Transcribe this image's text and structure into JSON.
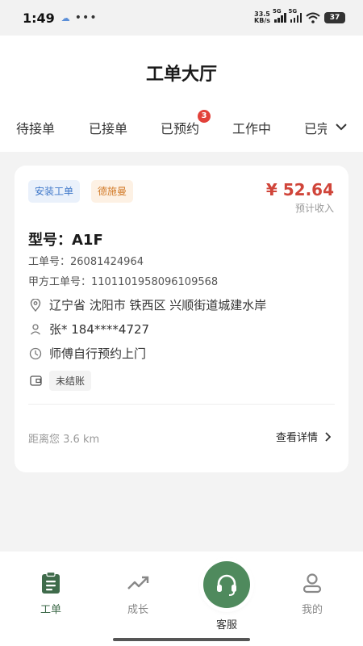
{
  "status_bar": {
    "time": "1:49",
    "net_speed_value": "33.5",
    "net_speed_unit": "KB/s",
    "signal1": "5G",
    "signal2": "5G",
    "battery": "37"
  },
  "header": {
    "title": "工单大厅"
  },
  "tabs": [
    {
      "label": "待接单"
    },
    {
      "label": "已接单"
    },
    {
      "label": "已预约",
      "badge": "3"
    },
    {
      "label": "工作中"
    },
    {
      "label": "已完"
    }
  ],
  "order": {
    "tags": [
      "安装工单",
      "德施曼"
    ],
    "price": "¥ 52.64",
    "price_label": "预计收入",
    "model": "型号：A1F",
    "order_no": "工单号：26081424964",
    "party_order_no": "甲方工单号：1101101958096109568",
    "address": "辽宁省 沈阳市 铁西区 兴顺街道城建水岸",
    "customer": "张* 184****4727",
    "appointment": "师傅自行预约上门",
    "settlement": "未结账",
    "distance": "距离您 3.6 km",
    "details_label": "查看详情"
  },
  "bottom_nav": {
    "items": [
      {
        "label": "工单"
      },
      {
        "label": "成长"
      },
      {
        "label": "客服"
      },
      {
        "label": "我的"
      }
    ]
  },
  "colors": {
    "accent": "#4f8a5d",
    "price": "#d0453a",
    "badge": "#e2413a"
  }
}
